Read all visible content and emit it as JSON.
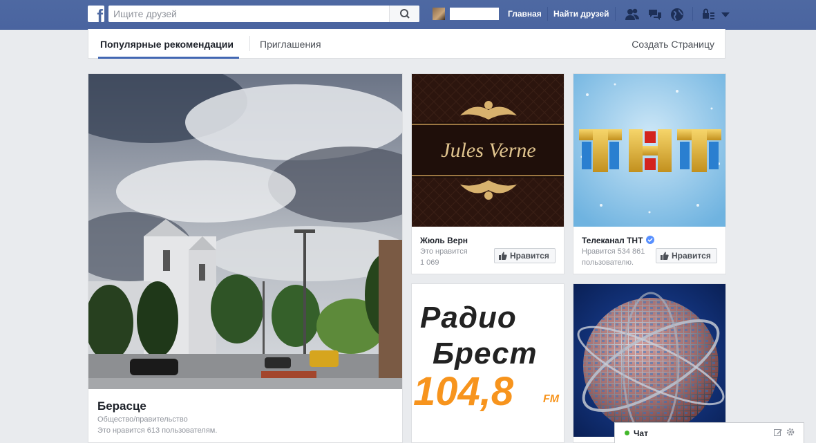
{
  "topbar": {
    "search_placeholder": "Ищите друзей",
    "nav_home": "Главная",
    "nav_find_friends": "Найти друзей"
  },
  "tabs": {
    "popular": "Популярные рекомендации",
    "invites": "Приглашения",
    "create_page": "Создать Страницу"
  },
  "cards": {
    "berasce": {
      "title": "Берасце",
      "category": "Общество/правительство",
      "likes": "Это нравится 613 пользователям."
    },
    "jules": {
      "title": "Жюль Верн",
      "likes_line1": "Это нравится",
      "likes_line2": "1 069",
      "button": "Нравится",
      "logo_text": "Jules Verne"
    },
    "tnt": {
      "title": "Телеканал ТНТ",
      "likes_line1": "Нравится 534 861",
      "likes_line2": "пользователю.",
      "button": "Нравится"
    },
    "radio": {
      "line1": "Радио",
      "line2": "Брест",
      "freq": "104,8",
      "unit": "FM"
    }
  },
  "chat": {
    "label": "Чат"
  },
  "colors": {
    "brand_blue": "#4e69a2",
    "accent": "#4267b2",
    "online": "#42b72a",
    "radio_orange": "#f7941d"
  }
}
